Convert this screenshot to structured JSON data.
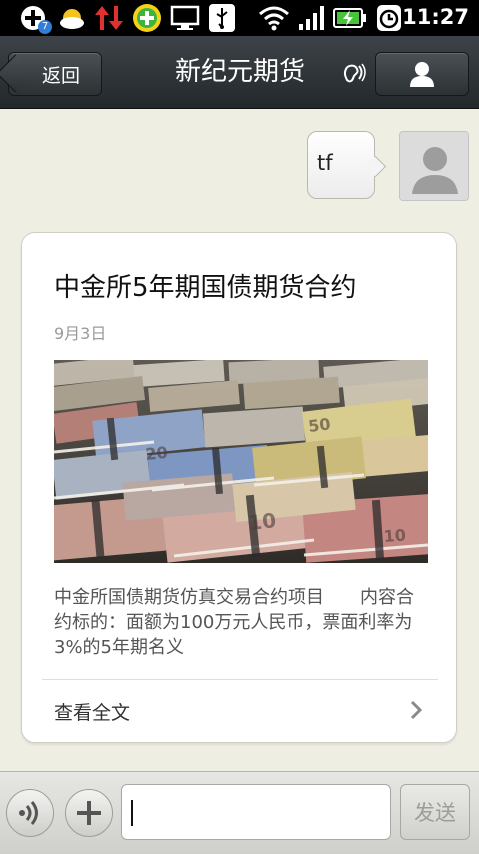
{
  "status_bar": {
    "time": "11:27",
    "notification_badge": "7",
    "icons": [
      "add-circle-icon",
      "weather-icon",
      "data-transfer-icon",
      "app-plus-icon",
      "monitor-icon",
      "usb-icon",
      "wifi-icon",
      "signal-icon",
      "battery-charging-icon",
      "alarm-icon"
    ]
  },
  "header": {
    "back_label": "返回",
    "title": "新纪元期货",
    "ear_icon": "ear-mode-icon",
    "profile_icon": "person-icon"
  },
  "chat": {
    "sent_message": "tf",
    "article": {
      "title": "中金所5年期国债期货合约",
      "date": "9月3日",
      "image_icon": "euro-banknotes-photo",
      "description": "中金所国债期货仿真交易合约项目　　内容合约标的：面额为100万元人民币，票面利率为3%的5年期名义",
      "read_more": "查看全文"
    }
  },
  "input_bar": {
    "voice_icon": "voice-icon",
    "plus_icon": "plus-icon",
    "text_value": "",
    "send_label": "发送"
  },
  "colors": {
    "chat_background": "#efeee3",
    "header_background": "#2f3437",
    "status_bar": "#000000"
  }
}
